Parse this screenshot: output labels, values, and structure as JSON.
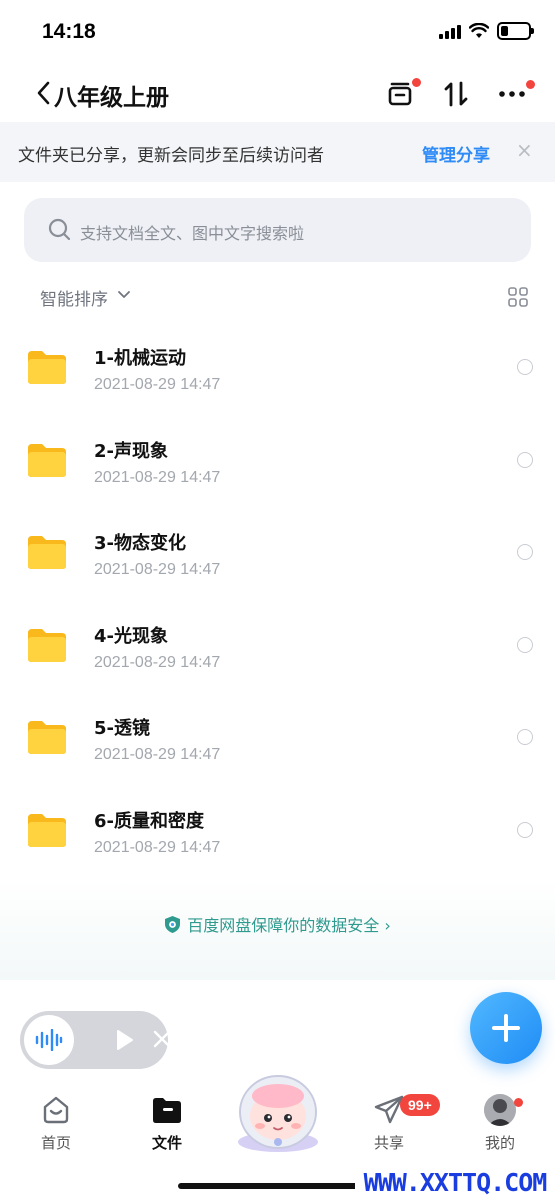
{
  "status_bar": {
    "time": "14:18"
  },
  "nav": {
    "title": "八年级上册"
  },
  "share_banner": {
    "text": "文件夹已分享，更新会同步至后续访问者",
    "link": "管理分享",
    "close": "×"
  },
  "search": {
    "placeholder": "支持文档全文、图中文字搜索啦"
  },
  "sort": {
    "label": "智能排序"
  },
  "files": [
    {
      "name": "1-机械运动",
      "date": "2021-08-29 14:47"
    },
    {
      "name": "2-声现象",
      "date": "2021-08-29 14:47"
    },
    {
      "name": "3-物态变化",
      "date": "2021-08-29 14:47"
    },
    {
      "name": "4-光现象",
      "date": "2021-08-29 14:47"
    },
    {
      "name": "5-透镜",
      "date": "2021-08-29 14:47"
    },
    {
      "name": "6-质量和密度",
      "date": "2021-08-29 14:47"
    }
  ],
  "security": {
    "text": "百度网盘保障你的数据安全 ›"
  },
  "tabs": [
    {
      "label": "首页",
      "icon": "home-icon"
    },
    {
      "label": "文件",
      "icon": "folder-icon"
    },
    {
      "label": "共享",
      "icon": "paper-plane-icon"
    },
    {
      "label": "我的",
      "icon": "avatar-icon"
    }
  ],
  "share_badge": "99+",
  "watermark": "WWW.XXTTQ.COM",
  "colors": {
    "accent": "#2f8bf5",
    "folder": "#ffcc33",
    "badge": "#f2453d",
    "security": "#2f9a8e"
  }
}
